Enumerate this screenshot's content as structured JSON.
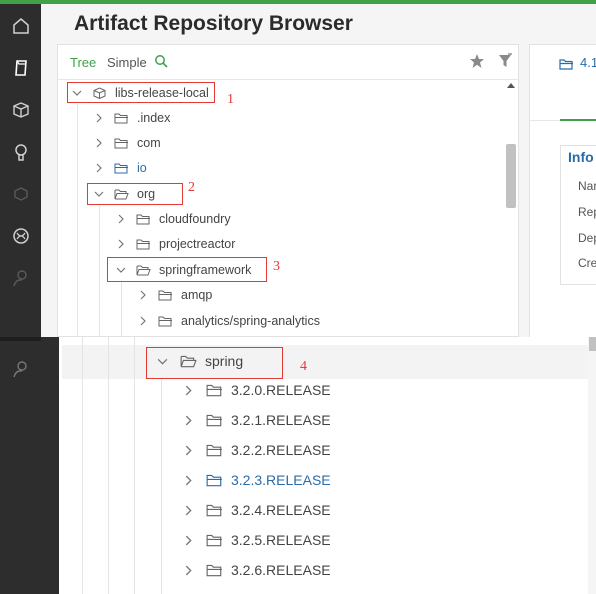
{
  "app": {
    "title": "Artifact Repository Browser",
    "accent_color": "#43a047",
    "sidebar_color": "#2d2d2d",
    "link_color": "#2a6ca8"
  },
  "sidebar": {
    "items": [
      {
        "icon": "home-icon"
      },
      {
        "icon": "artifacts-icon"
      },
      {
        "icon": "packages-icon"
      },
      {
        "icon": "search-bulb-icon"
      },
      {
        "icon": "builds-icon"
      },
      {
        "icon": "distribution-icon"
      },
      {
        "icon": "user-icon"
      },
      {
        "icon": "admin-user-icon"
      }
    ]
  },
  "tree_panel": {
    "tabs": [
      "Tree",
      "Simple"
    ],
    "active_tab": "Tree",
    "icons": [
      "search-icon",
      "star-icon",
      "filter-icon"
    ],
    "nodes": [
      {
        "label": "libs-release-local",
        "level": 0,
        "expanded": true,
        "icon": "repository-icon",
        "highlight": false
      },
      {
        "label": ".index",
        "level": 1,
        "expanded": false,
        "icon": "folder-icon",
        "highlight": false
      },
      {
        "label": "com",
        "level": 1,
        "expanded": false,
        "icon": "folder-icon",
        "highlight": false
      },
      {
        "label": "io",
        "level": 1,
        "expanded": false,
        "icon": "folder-icon",
        "highlight": true
      },
      {
        "label": "org",
        "level": 1,
        "expanded": true,
        "icon": "folder-icon",
        "highlight": false
      },
      {
        "label": "cloudfoundry",
        "level": 2,
        "expanded": false,
        "icon": "folder-icon",
        "highlight": false
      },
      {
        "label": "projectreactor",
        "level": 2,
        "expanded": false,
        "icon": "folder-icon",
        "highlight": false
      },
      {
        "label": "springframework",
        "level": 2,
        "expanded": true,
        "icon": "folder-icon",
        "highlight": false
      },
      {
        "label": "amqp",
        "level": 3,
        "expanded": false,
        "icon": "folder-icon",
        "highlight": false
      },
      {
        "label": "analytics/spring-analytics",
        "level": 3,
        "expanded": false,
        "icon": "folder-icon",
        "highlight": false
      }
    ]
  },
  "zoomed_tree": {
    "nodes": [
      {
        "label": "spring",
        "expanded": true,
        "highlight": false
      },
      {
        "label": "3.2.0.RELEASE",
        "expanded": false,
        "highlight": false
      },
      {
        "label": "3.2.1.RELEASE",
        "expanded": false,
        "highlight": false
      },
      {
        "label": "3.2.2.RELEASE",
        "expanded": false,
        "highlight": false
      },
      {
        "label": "3.2.3.RELEASE",
        "expanded": false,
        "highlight": true
      },
      {
        "label": "3.2.4.RELEASE",
        "expanded": false,
        "highlight": false
      },
      {
        "label": "3.2.5.RELEASE",
        "expanded": false,
        "highlight": false
      },
      {
        "label": "3.2.6.RELEASE",
        "expanded": false,
        "highlight": false
      }
    ]
  },
  "details_panel": {
    "header": "4.1",
    "section_title": "Info",
    "labels": [
      "Nar",
      "Rep",
      "Dep",
      "Cre"
    ]
  },
  "annotations": {
    "markers": [
      "1",
      "2",
      "3",
      "4"
    ],
    "color": "#e53935"
  }
}
